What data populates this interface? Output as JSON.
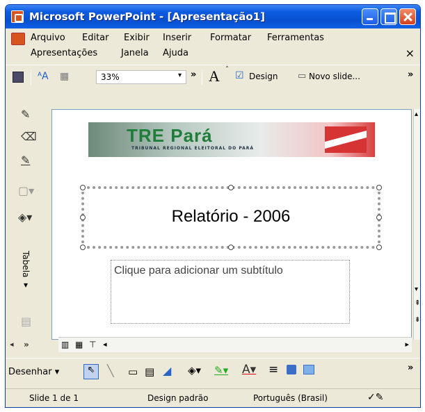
{
  "window": {
    "title": "Microsoft PowerPoint - [Apresentação1]"
  },
  "menu": {
    "items": [
      "Arquivo",
      "Editar",
      "Exibir",
      "Inserir",
      "Formatar",
      "Ferramentas",
      "Apresentações",
      "Janela",
      "Ajuda"
    ],
    "close": "×"
  },
  "toolbar": {
    "zoom": "33%",
    "design_label": "Design",
    "new_slide_label": "Novo slide..."
  },
  "vtoolbar": {
    "tabela_label": "Tabela ▾"
  },
  "slide": {
    "banner_logo": "TRE Pará",
    "banner_subtitle": "TRIBUNAL REGIONAL ELEITORAL DO PARÁ",
    "title": "Relatório - 2006",
    "subtitle_placeholder": "Clique para adicionar um subtítulo"
  },
  "drawbar": {
    "desenhar_label": "Desenhar ▾"
  },
  "status": {
    "slide": "Slide 1 de 1",
    "design": "Design padrão",
    "language": "Português (Brasil)"
  },
  "colors": {
    "titlebar": "#0a50d2",
    "chrome": "#ece9d8",
    "banner_green": "#1f7d3a",
    "banner_red": "#d63434"
  }
}
